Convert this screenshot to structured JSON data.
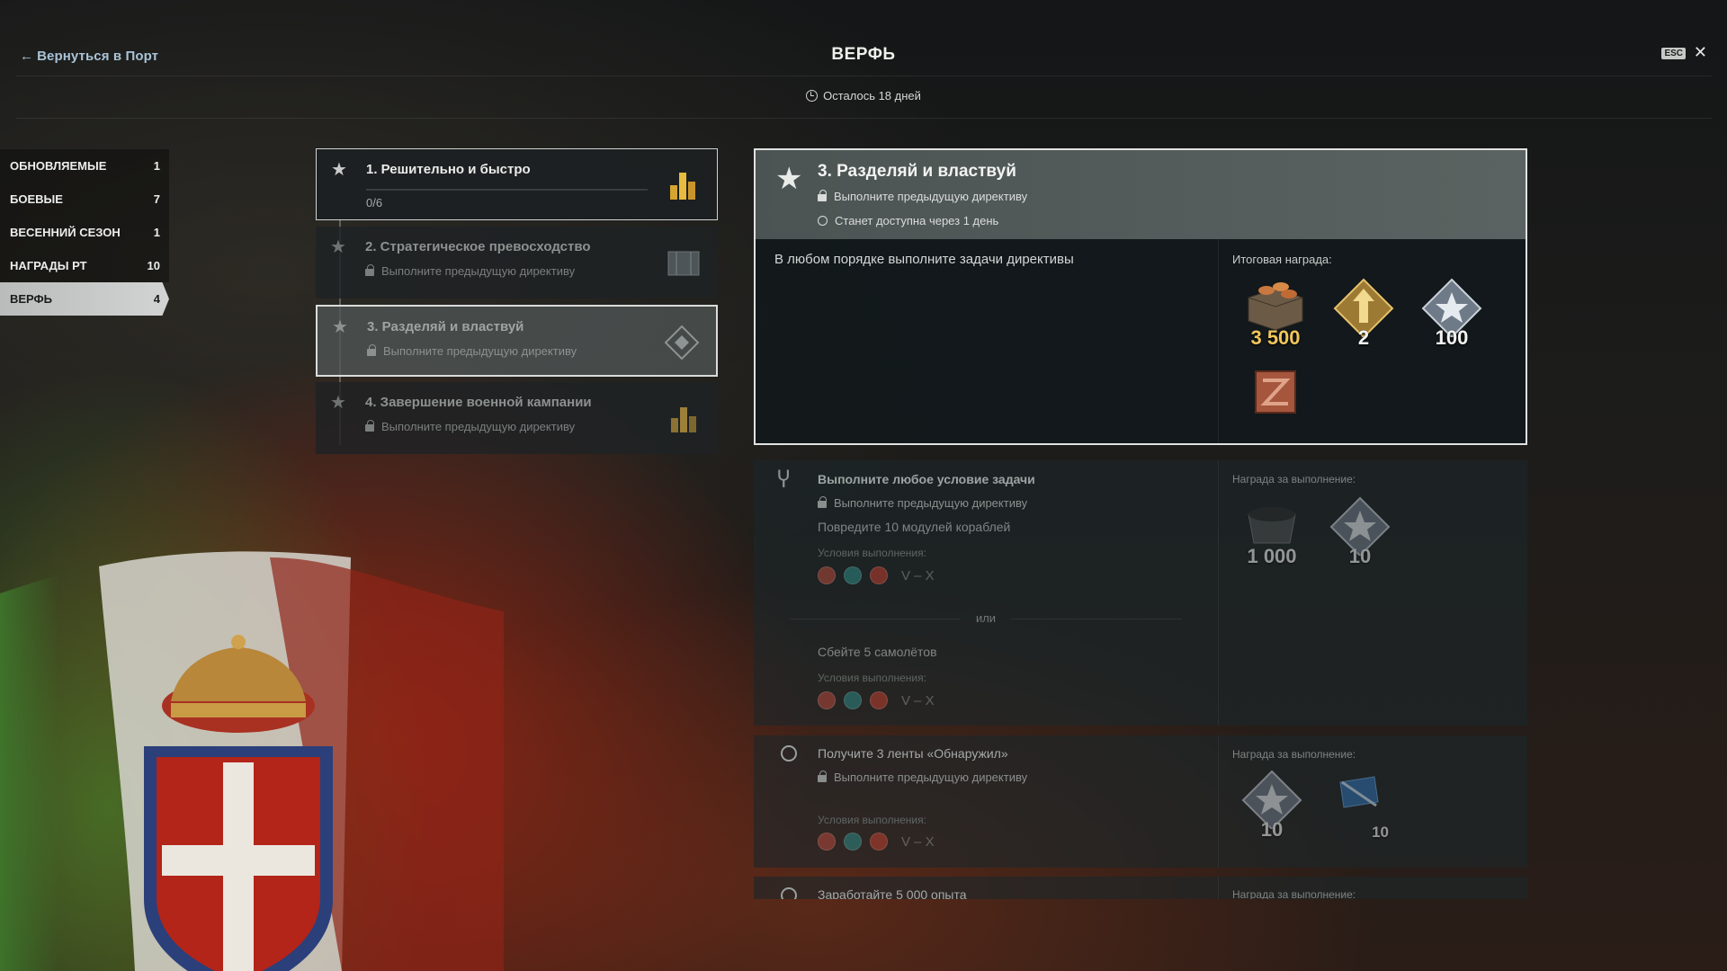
{
  "header": {
    "back_label": "Вернуться в Порт",
    "title": "ВЕРФЬ",
    "esc_label": "ESC",
    "time_left": "Осталось 18 дней"
  },
  "sidebar": {
    "items": [
      {
        "label": "ОБНОВЛЯЕМЫЕ",
        "count": "1"
      },
      {
        "label": "БОЕВЫЕ",
        "count": "7"
      },
      {
        "label": "ВЕСЕННИЙ СЕЗОН",
        "count": "1"
      },
      {
        "label": "НАГРАДЫ РТ",
        "count": "10"
      },
      {
        "label": "ВЕРФЬ",
        "count": "4",
        "active": true
      }
    ]
  },
  "directives": [
    {
      "title": "1. Решительно и быстро",
      "progress": "0/6",
      "thumb": "gold-coins-icon"
    },
    {
      "title": "2. Стратегическое превосходство",
      "status": "Выполните предыдущую директиву",
      "thumb": "ship-blueprint-icon"
    },
    {
      "title": "3. Разделяй и властвуй",
      "status": "Выполните предыдущую директиву",
      "thumb": "diamond-emblem-icon"
    },
    {
      "title": "4. Завершение военной кампании",
      "status": "Выполните предыдущую директиву",
      "thumb": "gold-coins-icon"
    }
  ],
  "detail": {
    "title": "3. Разделяй и властвуй",
    "lock_text": "Выполните предыдущую директиву",
    "available_text": "Станет доступна через 1 день",
    "description": "В любом порядке выполните задачи директивы",
    "reward_label": "Итоговая награда:",
    "rewards": [
      {
        "icon": "credits-crate-icon",
        "amount": "3 500"
      },
      {
        "icon": "gold-arrow-rank-icon",
        "amount": "2"
      },
      {
        "icon": "silver-star-icon",
        "amount": "100"
      },
      {
        "icon": "supply-container-icon",
        "amount": ""
      }
    ]
  },
  "tasks": [
    {
      "title": "Выполните любое условие задачи",
      "lock_text": "Выполните предыдущую директиву",
      "option1": "Повредите 10 модулей кораблей",
      "cond_label": "Условия выполнения:",
      "tier": "V – X",
      "or_label": "или",
      "option2": "Сбейте 5 самолётов",
      "reward_label": "Награда за выполнение:",
      "rewards": [
        {
          "icon": "coal-cart-icon",
          "amount": "1 000"
        },
        {
          "icon": "silver-star-icon",
          "amount": "10"
        }
      ]
    },
    {
      "title": "Получите 3 ленты «Обнаружил»",
      "lock_text": "Выполните предыдущую директиву",
      "cond_label": "Условия выполнения:",
      "tier": "V – X",
      "reward_label": "Награда за выполнение:",
      "rewards": [
        {
          "icon": "silver-star-icon",
          "amount": "10"
        },
        {
          "icon": "blue-flag-icon",
          "amount": "10"
        }
      ]
    },
    {
      "title": "Заработайте 5 000 опыта",
      "reward_label": "Награда за выполнение:"
    }
  ],
  "colors": {
    "accent_gold": "#f2c65a",
    "panel_border": "#dfe2e1",
    "active_tab": "#c8cbca"
  }
}
